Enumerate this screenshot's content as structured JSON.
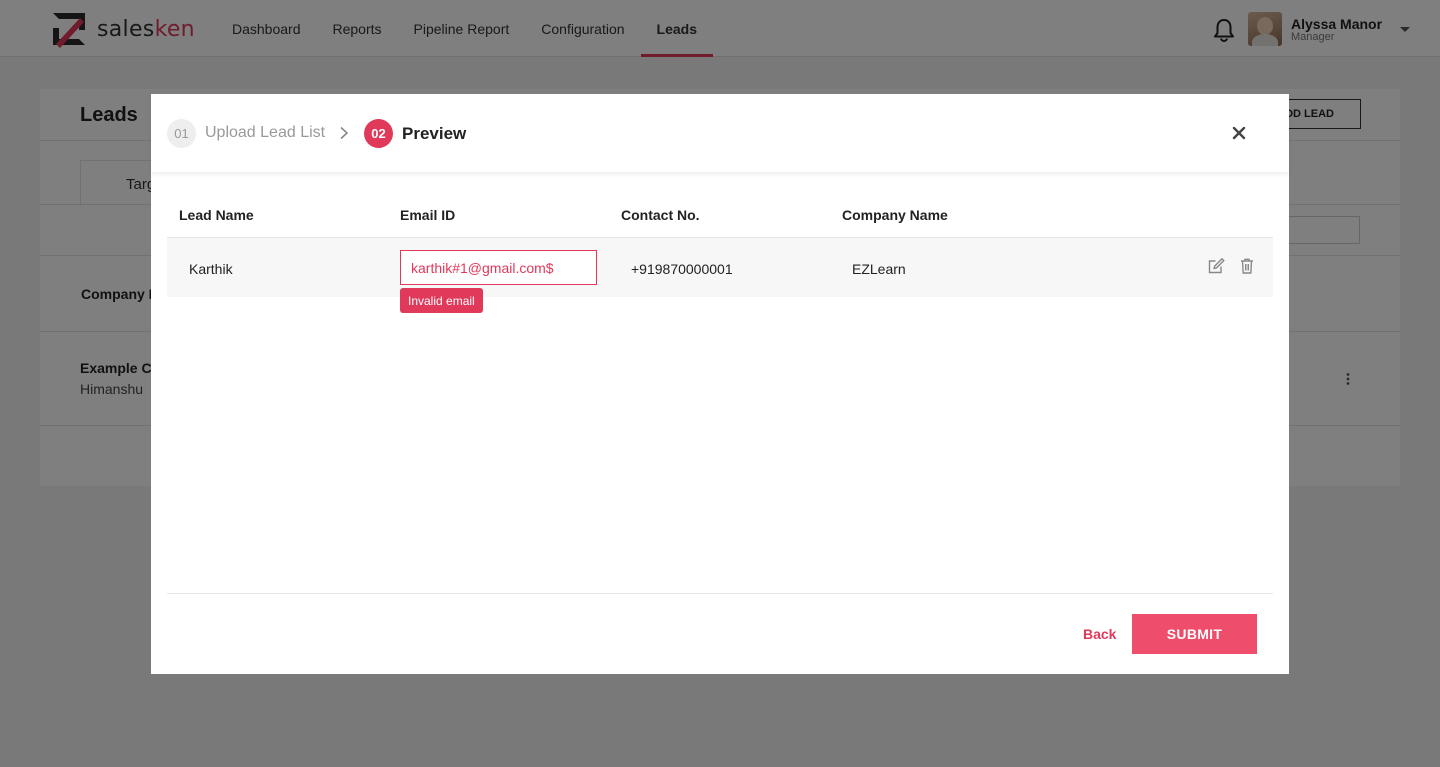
{
  "brand": {
    "name_prefix": "sales",
    "name_suffix": "ken",
    "accent_color": "#e0395a"
  },
  "nav": {
    "items": [
      {
        "label": "Dashboard",
        "active": false
      },
      {
        "label": "Reports",
        "active": false
      },
      {
        "label": "Pipeline Report",
        "active": false
      },
      {
        "label": "Configuration",
        "active": false
      },
      {
        "label": "Leads",
        "active": true
      }
    ]
  },
  "user": {
    "name": "Alyssa Manor",
    "role": "Manager"
  },
  "icons": [
    "bell-icon",
    "chevron-down-icon",
    "chevron-right-icon",
    "close-icon",
    "edit-icon",
    "trash-icon",
    "kebab-icon"
  ],
  "background_page": {
    "title": "Leads",
    "add_button_partial": "DD LEAD",
    "tab_partial": "Targ",
    "column_partial": "Company N",
    "row_title_partial": "Example Co",
    "row_sub_partial": "Himanshu"
  },
  "modal": {
    "steps": [
      {
        "number": "01",
        "label": "Upload Lead List",
        "active": false
      },
      {
        "number": "02",
        "label": "Preview",
        "active": true
      }
    ],
    "columns": [
      "Lead Name",
      "Email ID",
      "Contact No.",
      "Company Name"
    ],
    "rows": [
      {
        "lead_name": "Karthik",
        "email": "karthik#1@gmail.com$",
        "contact": "+919870000001",
        "company": "EZLearn",
        "error": "Invalid email"
      }
    ],
    "back_label": "Back",
    "submit_label": "SUBMIT"
  }
}
